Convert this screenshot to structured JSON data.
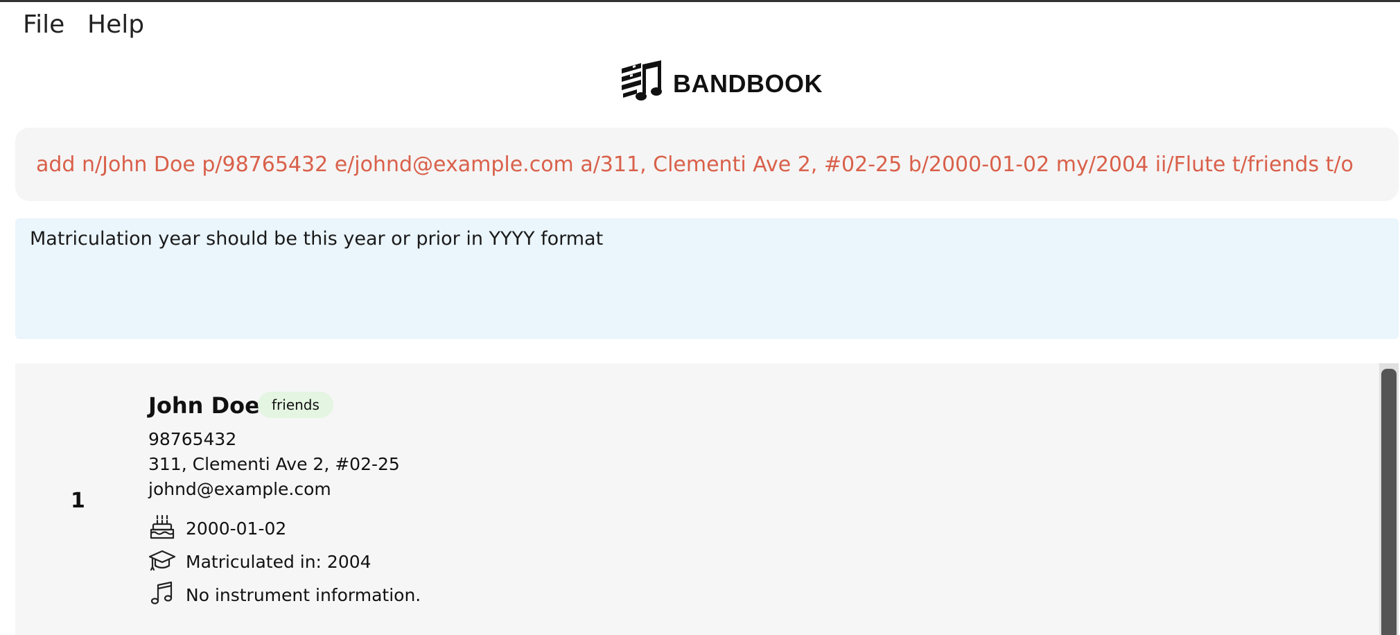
{
  "menu": {
    "file": "File",
    "help": "Help"
  },
  "brand": {
    "name": "BANDBOOK"
  },
  "command": {
    "value": "add n/John Doe p/98765432 e/johnd@example.com a/311, Clementi Ave 2, #02-25 b/2000-01-02 my/2004 ii/Flute t/friends t/o"
  },
  "result": {
    "message": "Matriculation year should be this year or prior in YYYY format"
  },
  "persons": [
    {
      "index": "1",
      "name": "John Doe",
      "tag": "friends",
      "phone": "98765432",
      "address": "311, Clementi Ave 2, #02-25",
      "email": "johnd@example.com",
      "birthday": "2000-01-02",
      "matriculation": "Matriculated in: 2004",
      "instrument": "No instrument information."
    }
  ],
  "colors": {
    "command_text": "#d9604a",
    "result_bg": "#eaf5fc",
    "tag_bg": "#e4f5e2"
  },
  "icons": {
    "logo": "music-notes-logo-icon",
    "birthday": "birthday-cake-icon",
    "matriculation": "graduation-cap-icon",
    "instrument": "music-note-icon"
  }
}
